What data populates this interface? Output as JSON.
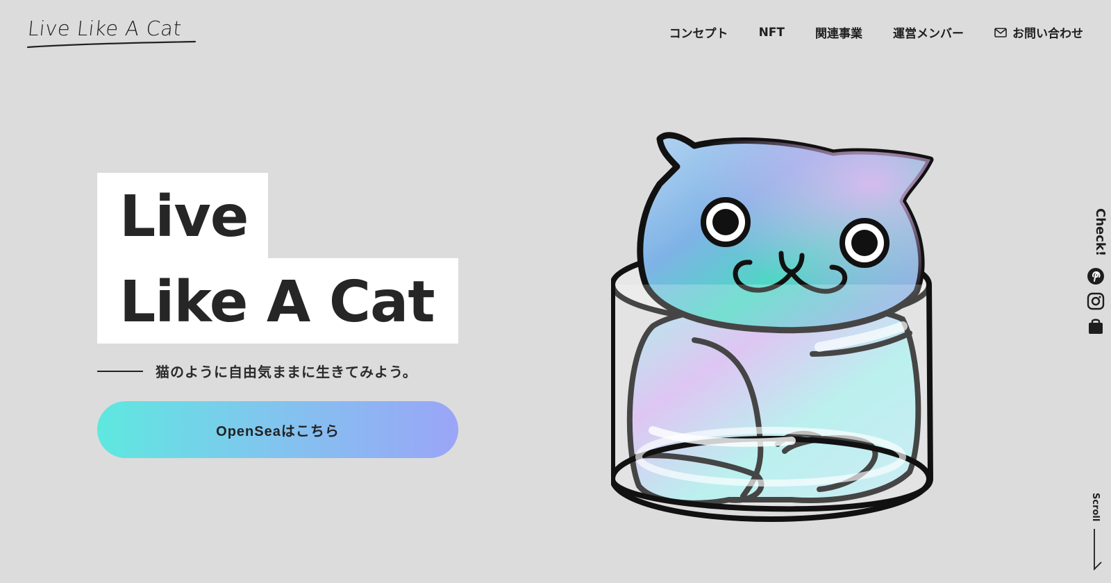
{
  "header": {
    "logo_text": "Live Like A Cat",
    "nav": [
      {
        "label": "コンセプト"
      },
      {
        "label": "NFT"
      },
      {
        "label": "関連事業"
      },
      {
        "label": "運営メンバー"
      },
      {
        "label": "お問い合わせ",
        "icon": "mail-icon"
      }
    ]
  },
  "hero": {
    "title_line1": "Live",
    "title_line2": "Like A Cat",
    "tagline": "猫のように自由気ままに生きてみよう。",
    "cta_label": "OpenSeaはこちら"
  },
  "side": {
    "check_label": "Check!",
    "icons": [
      "pinterest-icon",
      "instagram-icon",
      "shop-bag-icon"
    ],
    "scroll_label": "Scroll"
  },
  "colors": {
    "background": "#dcdcdc",
    "cta_gradient_start": "#5ee8df",
    "cta_gradient_end": "#9aa5f7",
    "text": "#1e1e1e"
  }
}
